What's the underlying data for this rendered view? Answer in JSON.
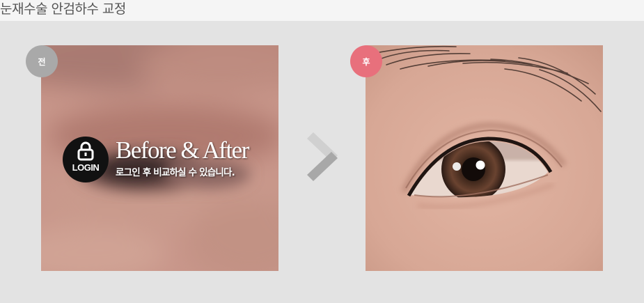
{
  "page": {
    "title": "눈재수술 안검하수 교정"
  },
  "before": {
    "badge": "전"
  },
  "after": {
    "badge": "후"
  },
  "login_overlay": {
    "icon": "lock-icon",
    "login_label": "LOGIN",
    "headline": "Before & After",
    "message": "로그인 후 비교하실 수 있습니다."
  },
  "colors": {
    "before_badge": "#a9a9a9",
    "after_badge": "#e8707c",
    "background": "#e3e3e3"
  }
}
